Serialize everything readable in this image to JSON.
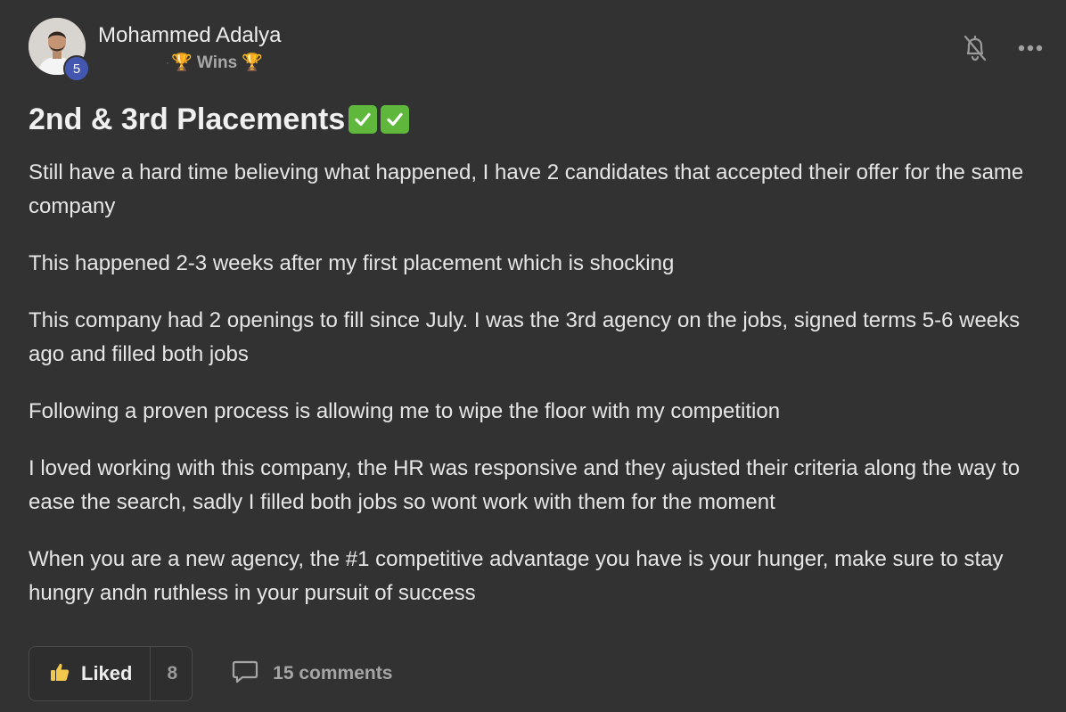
{
  "author": {
    "name": "Mohammed Adalya",
    "level": "5",
    "category": "🏆 Wins 🏆"
  },
  "post": {
    "title": "2nd & 3rd Placements",
    "paragraphs": [
      "Still have a hard time believing what happened, I have 2 candidates that accepted their offer for the same company",
      "This happened 2-3 weeks after my first placement which is shocking",
      "This company had 2 openings to fill since July. I was the 3rd agency on the jobs, signed terms 5-6 weeks ago and filled both jobs",
      "Following a proven process is allowing me to wipe the floor with my competition",
      "I loved working with this company, the HR was responsive and they ajusted their criteria along the way to ease the search, sadly I filled both jobs so wont work with them for the moment",
      "When you are a new agency, the #1 competitive advantage you have is your hunger, make sure to stay hungry andn ruthless in your pursuit of success"
    ]
  },
  "actions": {
    "like_label": "Liked",
    "like_count": "8",
    "comments_label": "15 comments"
  },
  "icons": {
    "bell": "bell-off-icon",
    "more": "more-horizontal-icon",
    "like": "thumbs-up-icon",
    "comment": "comment-icon",
    "check": "check-mark-icon"
  },
  "colors": {
    "background": "#323232",
    "level_badge": "#4457b0",
    "check_green": "#5fb83b",
    "like_yellow": "#f2c94c"
  }
}
